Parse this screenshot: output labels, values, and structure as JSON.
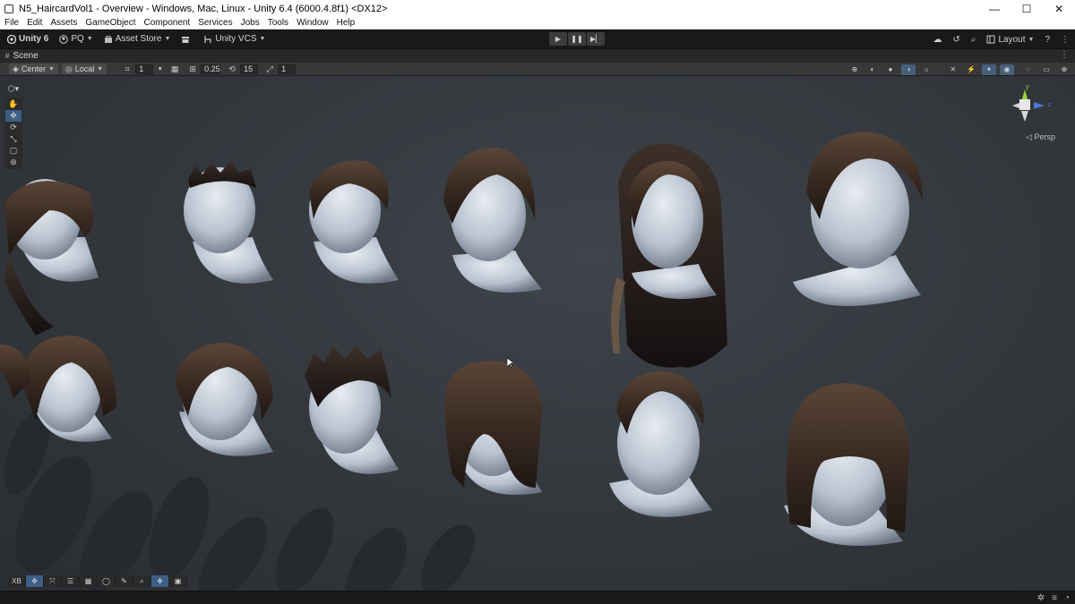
{
  "window": {
    "title": "N5_HaircardVol1 - Overview - Windows, Mac, Linux - Unity 6.4 (6000.4.8f1) <DX12>",
    "minimize": "—",
    "maximize": "☐",
    "close": "✕"
  },
  "menu": [
    "File",
    "Edit",
    "Assets",
    "GameObject",
    "Component",
    "Services",
    "Jobs",
    "Tools",
    "Window",
    "Help"
  ],
  "toolbar": {
    "unity_label": "Unity 6",
    "account_label": "PQ",
    "asset_store_label": "Asset Store",
    "vcs_label": "Unity VCS",
    "play_icon": "▶",
    "pause_icon": "❚❚",
    "step_icon": "▶▏",
    "layout_label": "Layout",
    "icons": [
      "cloud-icon",
      "history-icon",
      "search-icon",
      "layout-icon",
      "help-icon",
      "kebab-icon"
    ]
  },
  "scene_tab": {
    "label": "Scene",
    "kebab": "⋮"
  },
  "scene_toolbar": {
    "pivot_label": "Center",
    "space_label": "Local",
    "grid_snap_value": "1",
    "increment_value": "0.25",
    "rotate_snap_value": "15",
    "scale_snap_value": "1"
  },
  "viewport": {
    "projection_label": "◁ Persp",
    "gizmo_axis_y": "y",
    "gizmo_axis_z": "z"
  },
  "overlay_toolbar": {
    "first_label": "XB"
  },
  "colors": {
    "accent": "#3c5f86",
    "gizmo_y": "#9ccf3a",
    "gizmo_z": "#4a78d8",
    "gizmo_x": "#d8d8d8",
    "background": "#191919"
  }
}
